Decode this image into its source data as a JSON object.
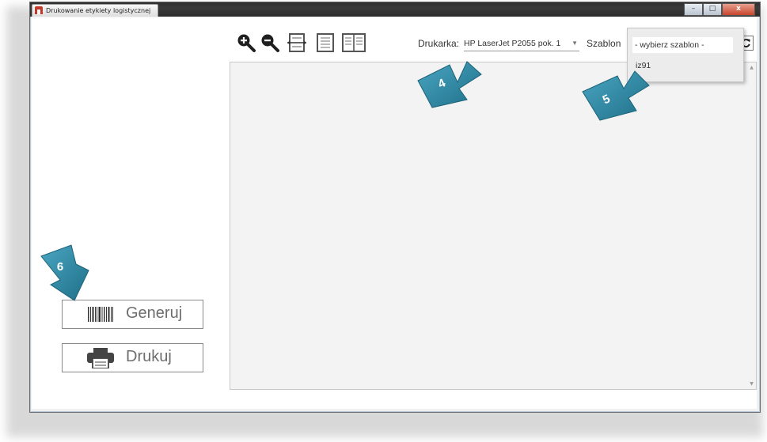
{
  "window": {
    "title": "Drukowanie etykiety logistycznej",
    "buttons": {
      "minimize": "–",
      "maximize": "□",
      "close": "x"
    }
  },
  "toolbar": {
    "zoom_in_icon": "zoom-in-icon",
    "zoom_out_icon": "zoom-out-icon",
    "fit_width_icon": "fit-width-icon",
    "single_page_icon": "single-page-icon",
    "two_pages_icon": "two-pages-icon",
    "printer_label": "Drukarka:",
    "printer_value": "HP LaserJet P2055 pok. 1",
    "template_label": "Szablon",
    "refresh_icon": "refresh-icon"
  },
  "template_dropdown": {
    "selected": "- wybierz szablon -",
    "options": [
      "iz91"
    ]
  },
  "sidebar": {
    "generate_label": "Generuj",
    "print_label": "Drukuj"
  },
  "markers": [
    {
      "number": "4"
    },
    {
      "number": "5"
    },
    {
      "number": "6"
    }
  ],
  "colors": {
    "marker": "#2a7f9a",
    "marker_light": "#4aa6c2",
    "close_button": "#c8452c"
  }
}
